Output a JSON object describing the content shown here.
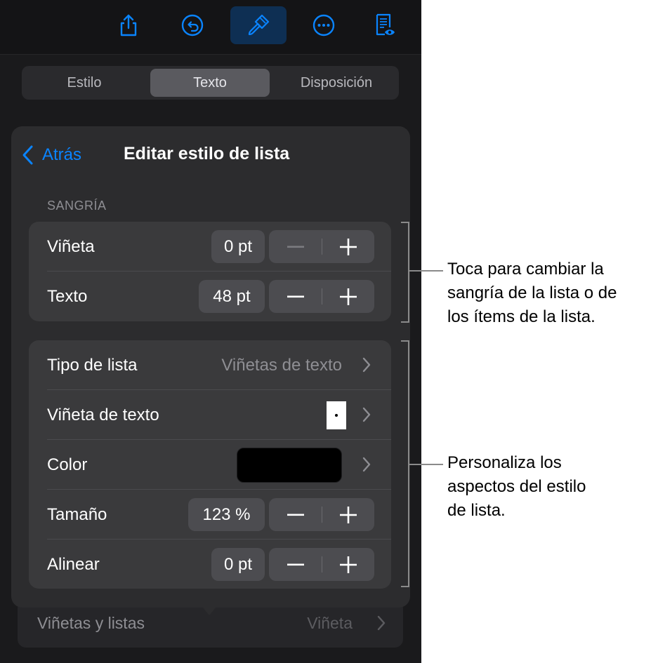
{
  "toolbar": {
    "buttons": [
      {
        "icon": "share-icon"
      },
      {
        "icon": "undo-icon"
      },
      {
        "icon": "format-brush-icon",
        "active": true
      },
      {
        "icon": "more-icon"
      },
      {
        "icon": "reading-view-icon"
      }
    ]
  },
  "tabs": [
    {
      "label": "Estilo"
    },
    {
      "label": "Texto",
      "selected": true
    },
    {
      "label": "Disposición"
    }
  ],
  "popover": {
    "back_label": "Atrás",
    "title": "Editar estilo de lista",
    "indent_section": "SANGRÍA",
    "indent_rows": [
      {
        "label": "Viñeta",
        "value": "0 pt"
      },
      {
        "label": "Texto",
        "value": "48 pt"
      }
    ],
    "style_rows": {
      "list_type": {
        "label": "Tipo de lista",
        "value": "Viñetas de texto"
      },
      "text_bullet": {
        "label": "Viñeta de texto"
      },
      "color": {
        "label": "Color",
        "swatch": "#000000"
      },
      "size": {
        "label": "Tamaño",
        "value": "123 %"
      },
      "align": {
        "label": "Alinear",
        "value": "0 pt"
      }
    }
  },
  "bottom_row": {
    "label": "Viñetas y listas",
    "value": "Viñeta"
  },
  "callouts": {
    "indent": [
      "Toca para cambiar la",
      "sangría de la lista o de",
      "los ítems de la lista."
    ],
    "style": [
      "Personaliza los",
      "aspectos del estilo",
      "de lista."
    ]
  },
  "colors": {
    "accent": "#0a84ff",
    "panel": "#2c2c2e",
    "group": "#3a3a3c",
    "background": "#1a1a1c"
  }
}
